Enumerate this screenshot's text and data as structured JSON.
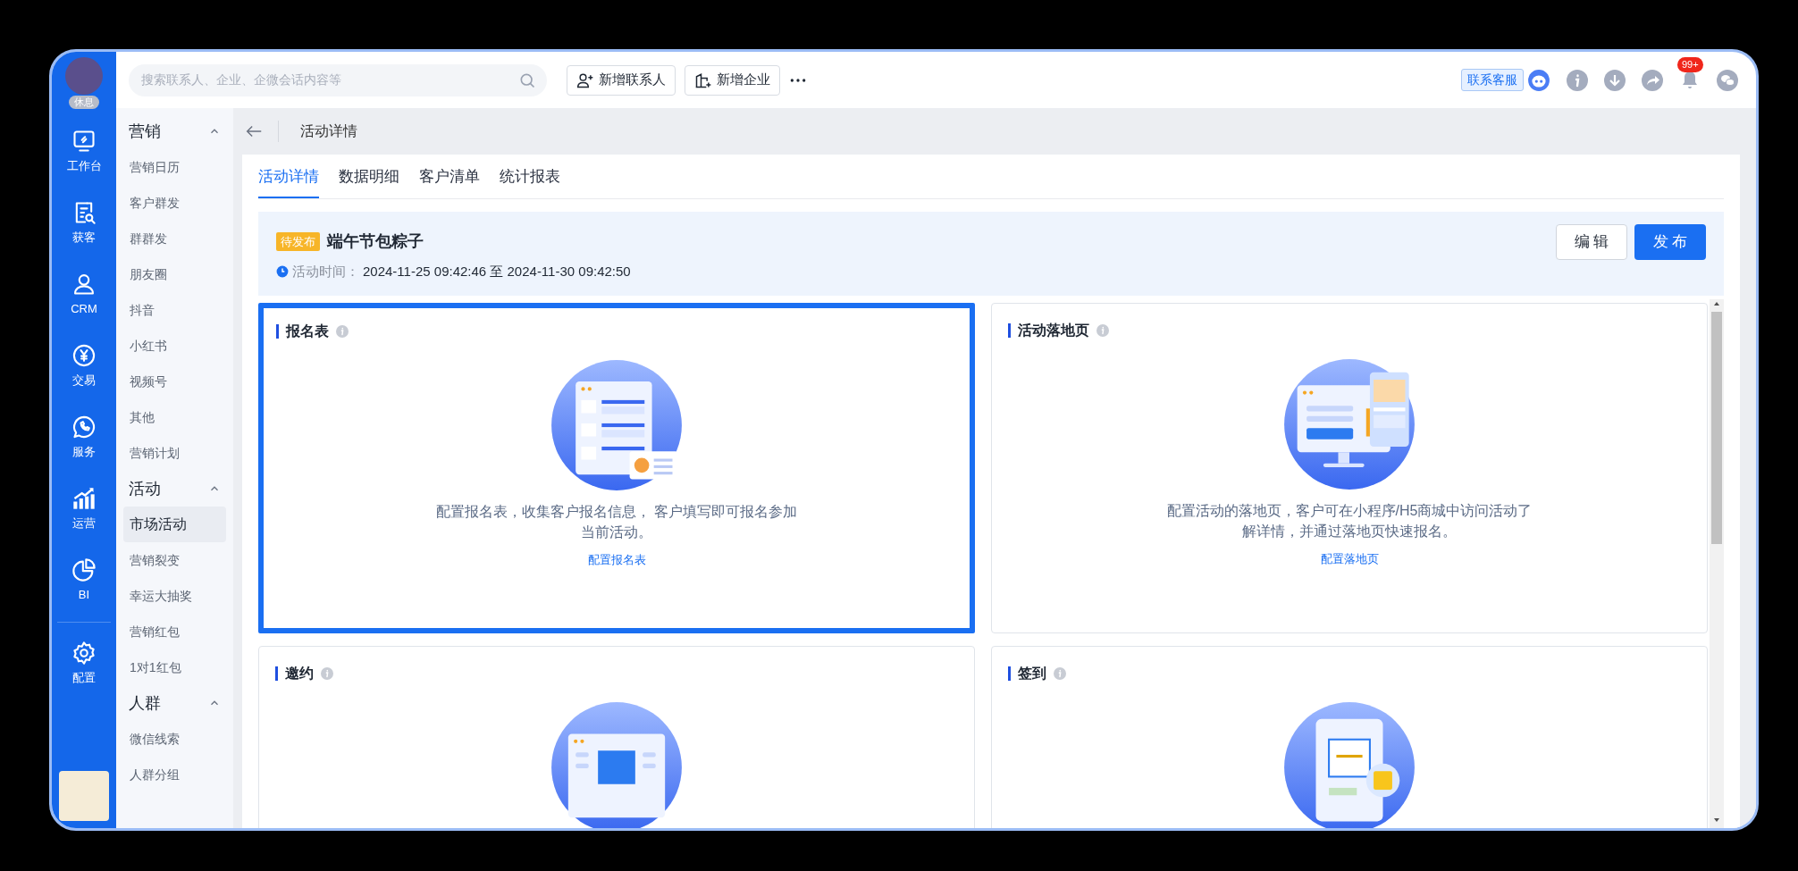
{
  "user": {
    "status": "休息"
  },
  "rail": [
    {
      "kind": "monitor",
      "label": "工作台"
    },
    {
      "kind": "search-doc",
      "label": "获客"
    },
    {
      "kind": "person",
      "label": "CRM"
    },
    {
      "kind": "yen",
      "label": "交易"
    },
    {
      "kind": "phone",
      "label": "服务"
    },
    {
      "kind": "chart",
      "label": "运营"
    },
    {
      "kind": "pie",
      "label": "BI"
    },
    {
      "kind": "gear",
      "label": "配置"
    }
  ],
  "header": {
    "search": {
      "placeholder": "搜索联系人、企业、企微会话内容等"
    },
    "buttons": [
      {
        "kind": "person-add",
        "label": "新增联系人"
      },
      {
        "kind": "building-add",
        "label": "新增企业"
      }
    ],
    "support_label": "联系客服",
    "notification_count": "99+"
  },
  "sidebar": [
    {
      "title": "营销",
      "expanded": true,
      "items": [
        {
          "label": "营销日历",
          "selected": false
        },
        {
          "label": "客户群发",
          "selected": false
        },
        {
          "label": "群群发",
          "selected": false
        },
        {
          "label": "朋友圈",
          "selected": false
        },
        {
          "label": "抖音",
          "selected": false
        },
        {
          "label": "小红书",
          "selected": false
        },
        {
          "label": "视频号",
          "selected": false
        },
        {
          "label": "其他",
          "selected": false
        },
        {
          "label": "营销计划",
          "selected": false
        }
      ]
    },
    {
      "title": "活动",
      "expanded": true,
      "items": [
        {
          "label": "市场活动",
          "selected": true
        },
        {
          "label": "营销裂变",
          "selected": false
        },
        {
          "label": "幸运大抽奖",
          "selected": false
        },
        {
          "label": "营销红包",
          "selected": false
        },
        {
          "label": "1对1红包",
          "selected": false
        }
      ]
    },
    {
      "title": "人群",
      "expanded": true,
      "items": [
        {
          "label": "微信线索",
          "selected": false
        },
        {
          "label": "人群分组",
          "selected": false
        }
      ]
    }
  ],
  "page_title": "活动详情",
  "tabs": [
    {
      "label": "活动详情",
      "selected": true
    },
    {
      "label": "数据明细",
      "selected": false
    },
    {
      "label": "客户清单",
      "selected": false
    },
    {
      "label": "统计报表",
      "selected": false
    }
  ],
  "activity": {
    "status": "待发布",
    "name": "端午节包粽子",
    "time_label": "活动时间：",
    "time_value": "2024-11-25 09:42:46 至 2024-11-30 09:42:50",
    "buttons": [
      {
        "kind": "outline",
        "label": "编 辑"
      },
      {
        "kind": "primary",
        "label": "发 布"
      }
    ]
  },
  "cards": [
    {
      "kind": "form",
      "title": "报名表",
      "selected": true,
      "description": "配置报名表，收集客户报名信息， 客户填写即可报名参加当前活动。",
      "link": "配置报名表"
    },
    {
      "kind": "landing",
      "title": "活动落地页",
      "selected": false,
      "description": "配置活动的落地页，客户可在小程序/H5商城中访问活动了解详情，并通过落地页快速报名。",
      "link": "配置落地页"
    },
    {
      "kind": "invite",
      "title": "邀约",
      "selected": false
    },
    {
      "kind": "checkin",
      "title": "签到",
      "selected": false
    }
  ]
}
